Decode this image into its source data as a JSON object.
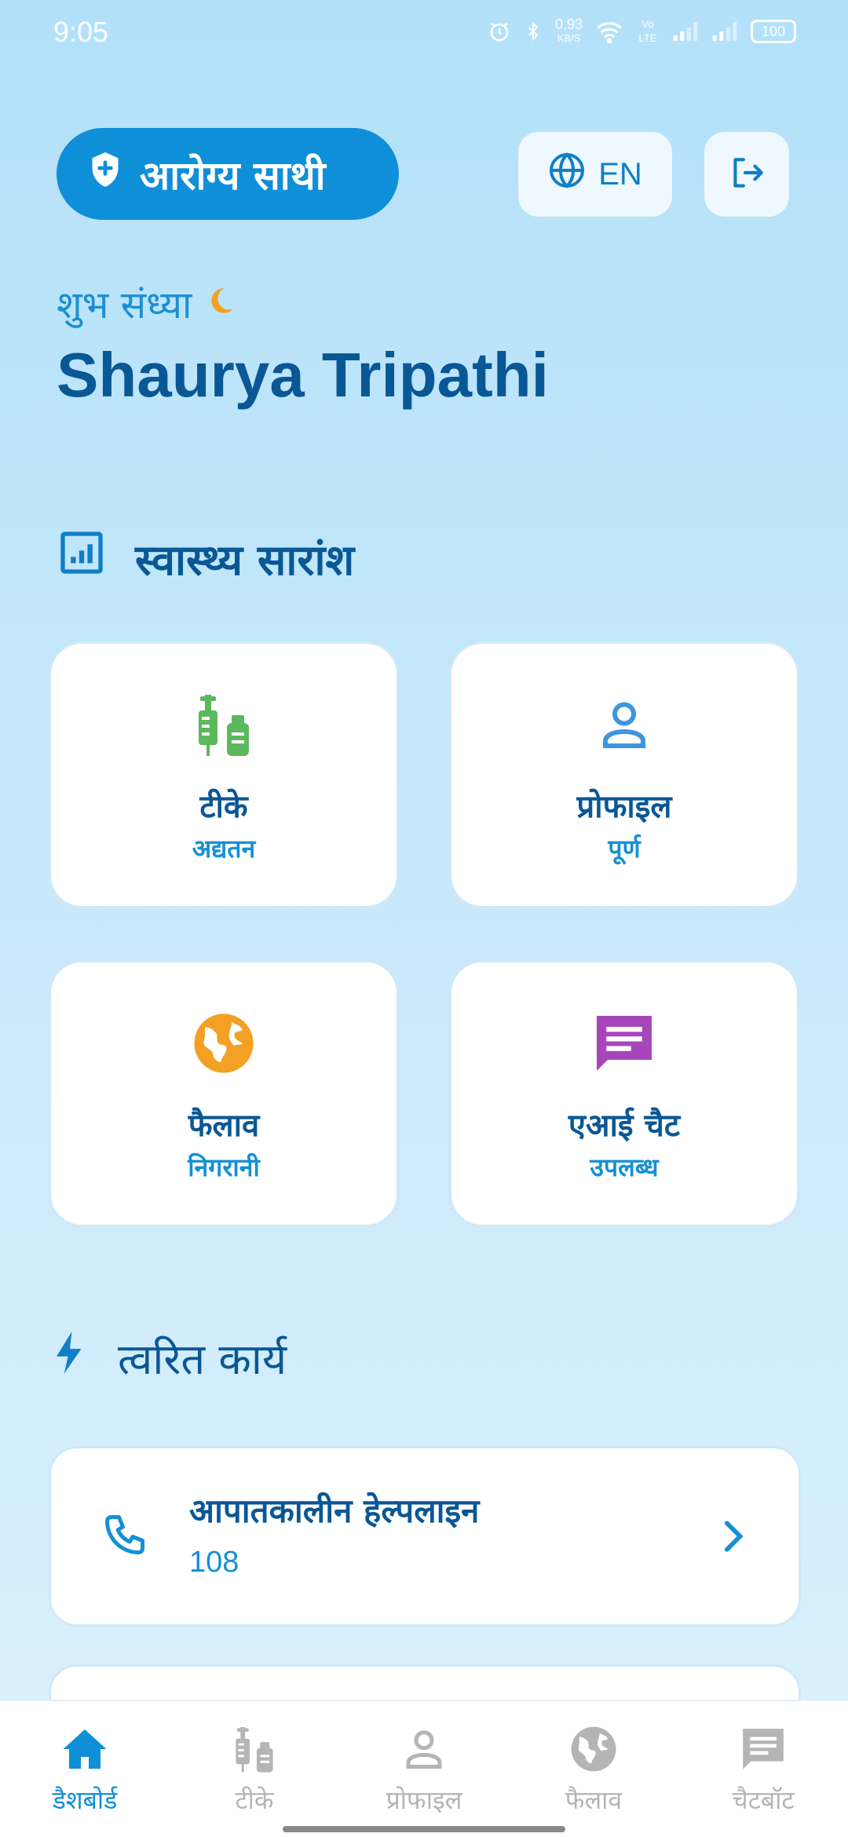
{
  "status_bar": {
    "time": "9:05",
    "net_speed_value": "0.93",
    "net_speed_unit": "KB/S",
    "volte": "Vo LTE",
    "battery": "100"
  },
  "header": {
    "brand": "आरोग्य साथी",
    "language": "EN"
  },
  "greeting": {
    "text": "शुभ संध्या",
    "name": "Shaurya Tripathi"
  },
  "health_summary": {
    "title": "स्वास्थ्य सारांश",
    "cards": [
      {
        "title": "टीके",
        "subtitle": "अद्यतन",
        "icon": "vaccine-icon",
        "color": "#5cb85c"
      },
      {
        "title": "प्रोफाइल",
        "subtitle": "पूर्ण",
        "icon": "person-icon",
        "color": "#3d96e0"
      },
      {
        "title": "फैलाव",
        "subtitle": "निगरानी",
        "icon": "globe-icon",
        "color": "#f4a025"
      },
      {
        "title": "एआई चैट",
        "subtitle": "उपलब्ध",
        "icon": "chat-icon",
        "color": "#a646b8"
      }
    ]
  },
  "quick_actions": {
    "title": "त्वरित कार्य",
    "items": [
      {
        "title": "आपातकालीन हेल्पलाइन",
        "number": "108"
      }
    ]
  },
  "bottom_nav": {
    "items": [
      {
        "label": "डैशबोर्ड",
        "icon": "home-icon",
        "active": true
      },
      {
        "label": "टीके",
        "icon": "vaccine-icon",
        "active": false
      },
      {
        "label": "प्रोफाइल",
        "icon": "person-icon",
        "active": false
      },
      {
        "label": "फैलाव",
        "icon": "globe-icon",
        "active": false
      },
      {
        "label": "चैटबॉट",
        "icon": "chat-icon",
        "active": false
      }
    ]
  },
  "colors": {
    "primary": "#0f8fd8",
    "heading": "#0a5795",
    "accent": "#1490d6",
    "inactive": "#b5b5b5"
  }
}
